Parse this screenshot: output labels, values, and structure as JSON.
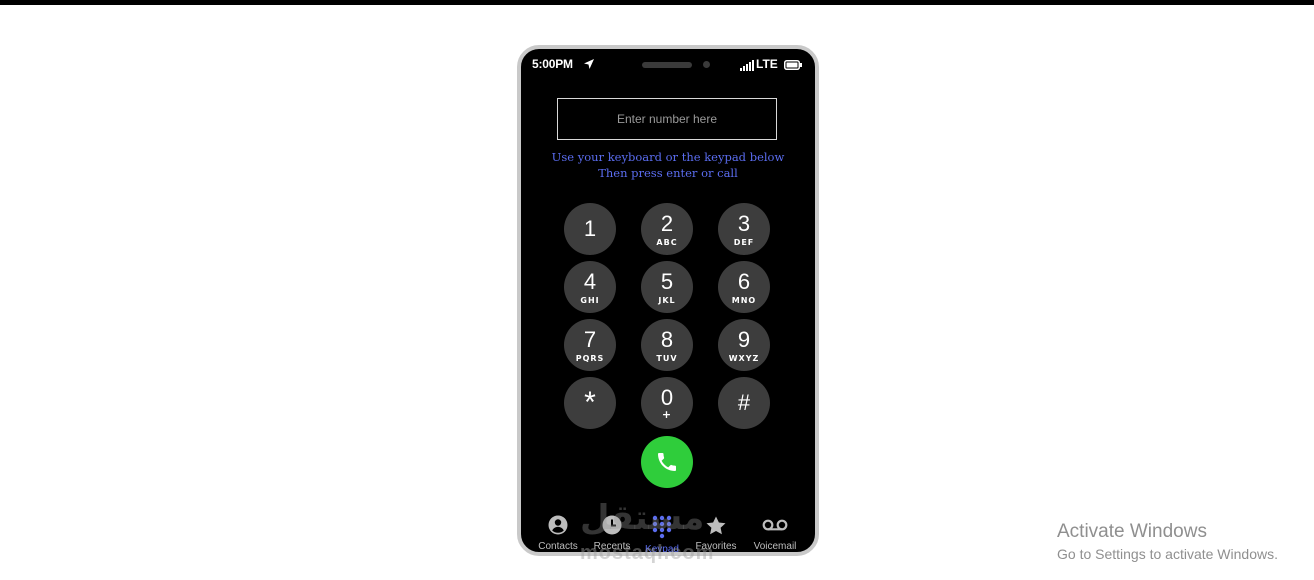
{
  "status_bar": {
    "time": "5:00PM",
    "network": "LTE"
  },
  "dialer": {
    "input_placeholder": "Enter number here",
    "hint_line1": "Use your keyboard or the keypad below",
    "hint_line2": "Then press enter or call"
  },
  "keypad": [
    {
      "digit": "1",
      "letters": ""
    },
    {
      "digit": "2",
      "letters": "ABC"
    },
    {
      "digit": "3",
      "letters": "DEF"
    },
    {
      "digit": "4",
      "letters": "GHI"
    },
    {
      "digit": "5",
      "letters": "JKL"
    },
    {
      "digit": "6",
      "letters": "MNO"
    },
    {
      "digit": "7",
      "letters": "PQRS"
    },
    {
      "digit": "8",
      "letters": "TUV"
    },
    {
      "digit": "9",
      "letters": "WXYZ"
    },
    {
      "digit": "*",
      "letters": ""
    },
    {
      "digit": "0",
      "letters": "+"
    },
    {
      "digit": "#",
      "letters": ""
    }
  ],
  "call_button": {
    "icon": "phone-icon",
    "color": "#2fcd3b"
  },
  "tab_bar": [
    {
      "label": "Contacts",
      "icon": "contacts-icon",
      "active": false
    },
    {
      "label": "Recents",
      "icon": "clock-icon",
      "active": false
    },
    {
      "label": "Keypad",
      "icon": "keypad-icon",
      "active": true
    },
    {
      "label": "Favorites",
      "icon": "star-icon",
      "active": false
    },
    {
      "label": "Voicemail",
      "icon": "voicemail-icon",
      "active": false
    }
  ],
  "watermark": {
    "text": "mostaql.com",
    "glyph": "مستقل"
  },
  "os_notice": {
    "title": "Activate Windows",
    "subtitle": "Go to Settings to activate Windows."
  },
  "colors": {
    "accent": "#5b6df0",
    "key_bg": "#3d3d3d",
    "phone_frame": "#c9c9c9"
  }
}
